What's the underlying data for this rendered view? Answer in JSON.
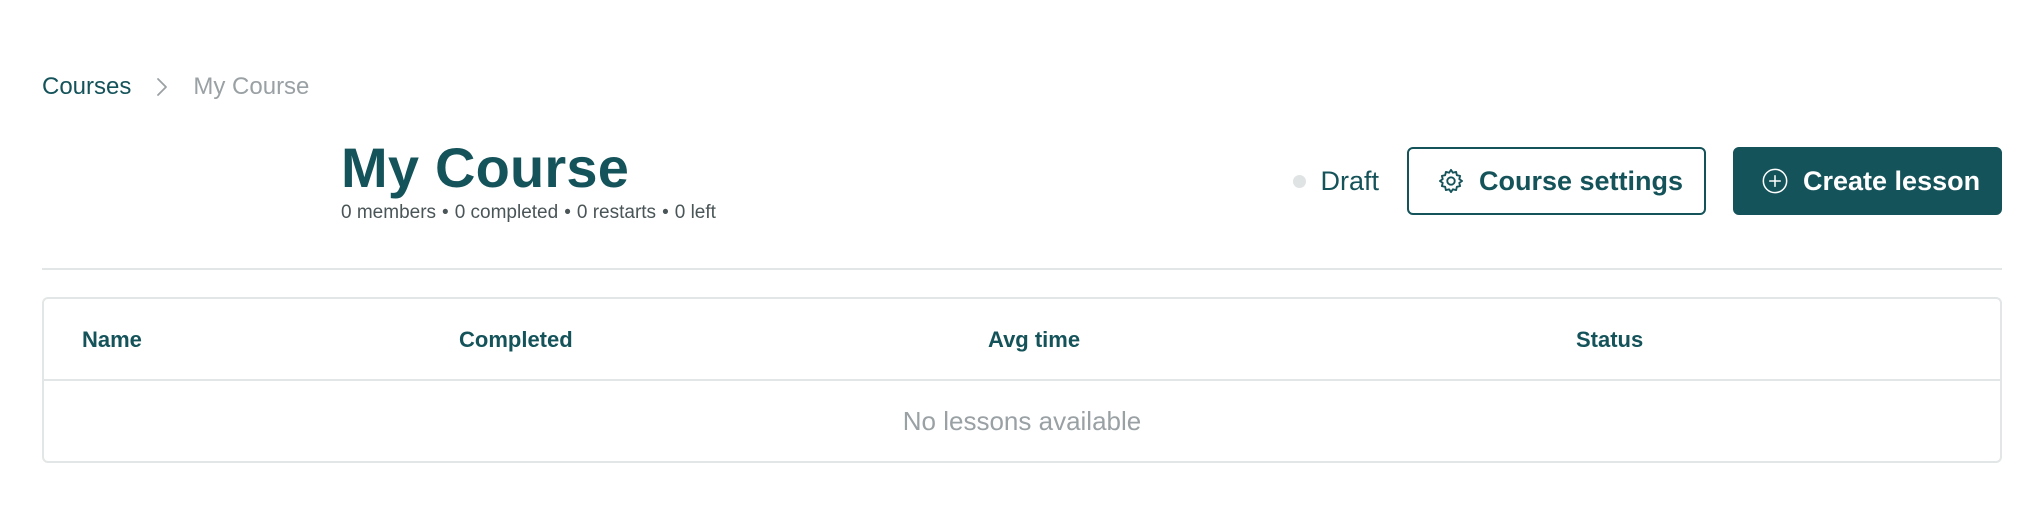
{
  "breadcrumb": {
    "parent": "Courses",
    "current": "My Course",
    "separator_icon": "chevron-right-icon"
  },
  "header": {
    "title": "My Course",
    "stats": {
      "members": "0 members",
      "completed": "0 completed",
      "restarts": "0 restarts",
      "left": "0 left",
      "separator": "•"
    }
  },
  "actions": {
    "status_label": "Draft",
    "course_settings_label": "Course settings",
    "course_settings_icon": "gear-icon",
    "create_lesson_label": "Create lesson",
    "create_lesson_icon": "plus-circle-icon"
  },
  "table": {
    "columns": [
      "Name",
      "Completed",
      "Avg time",
      "Status"
    ],
    "empty_message": "No lessons available"
  },
  "colors": {
    "primary": "#15535a",
    "muted": "#9aa1a4",
    "border": "#e3e6e7",
    "status_draft_dot": "#dfe3e4"
  }
}
